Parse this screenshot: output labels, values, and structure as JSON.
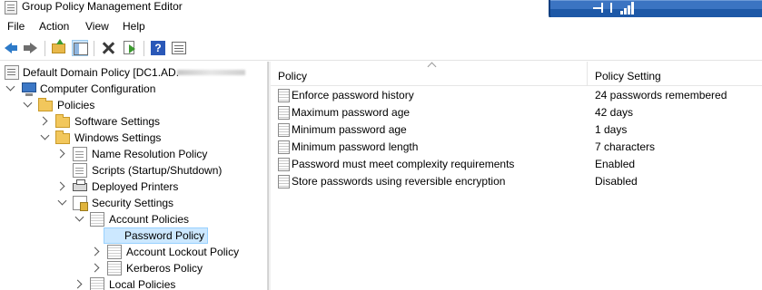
{
  "window": {
    "title": "Group Policy Management Editor"
  },
  "menu": [
    "File",
    "Action",
    "View",
    "Help"
  ],
  "toolbar": {
    "buttons": [
      "back-icon",
      "forward-icon",
      "up-folder-icon",
      "show-hide-tree-icon",
      "delete-icon",
      "export-list-icon",
      "help-icon",
      "properties-icon"
    ]
  },
  "tree": [
    {
      "label": "Default Domain Policy [DC1.AD.",
      "icon": "gpo-icon"
    },
    {
      "label": "Computer Configuration",
      "icon": "computer-icon"
    },
    {
      "label": "Policies",
      "icon": "folder-icon"
    },
    {
      "label": "Software Settings",
      "icon": "folder-icon"
    },
    {
      "label": "Windows Settings",
      "icon": "folder-icon"
    },
    {
      "label": "Name Resolution Policy",
      "icon": "document-icon"
    },
    {
      "label": "Scripts (Startup/Shutdown)",
      "icon": "document-icon"
    },
    {
      "label": "Deployed Printers",
      "icon": "printer-icon"
    },
    {
      "label": "Security Settings",
      "icon": "security-icon"
    },
    {
      "label": "Account Policies",
      "icon": "policy-icon"
    },
    {
      "label": "Password Policy",
      "icon": "policy-icon"
    },
    {
      "label": "Account Lockout Policy",
      "icon": "policy-icon"
    },
    {
      "label": "Kerberos Policy",
      "icon": "policy-icon"
    },
    {
      "label": "Local Policies",
      "icon": "policy-icon"
    }
  ],
  "list": {
    "columns": [
      "Policy",
      "Policy Setting"
    ],
    "rows": [
      {
        "policy": "Enforce password history",
        "setting": "24 passwords remembered"
      },
      {
        "policy": "Maximum password age",
        "setting": "42 days"
      },
      {
        "policy": "Minimum password age",
        "setting": "1 days"
      },
      {
        "policy": "Minimum password length",
        "setting": "7 characters"
      },
      {
        "policy": "Password must meet complexity requirements",
        "setting": "Enabled"
      },
      {
        "policy": "Store passwords using reversible encryption",
        "setting": "Disabled"
      }
    ]
  },
  "colors": {
    "selection": "#cce8ff",
    "overlay": "#1d58a7"
  }
}
